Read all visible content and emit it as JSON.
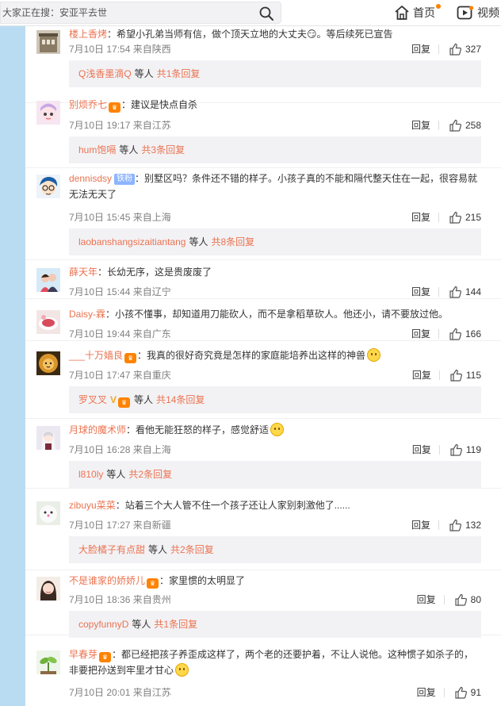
{
  "search": {
    "placeholder": "大家正在搜：安亚平去世"
  },
  "nav": {
    "home_label": "首页",
    "video_label": "视频"
  },
  "colors": {
    "link": "#eb7350",
    "meta": "#808080",
    "subbox_bg": "#f2f2f5",
    "sidebar": "#b9dcf3",
    "accent": "#ff8200"
  },
  "actions": {
    "reply_label": "回复",
    "more_replies_prefix": "共",
    "more_replies_suffix": "条回复",
    "people_suffix": "等人"
  },
  "comments": [
    {
      "user": "楼上香烤",
      "badges": [],
      "text": "：希望小孔弟当师有信，做个顶天立地的大丈夫😏。等后续死已宣告",
      "emoji_end": false,
      "time": "7月10日 17:54",
      "source": "来自陕西",
      "likes": "327",
      "sub": {
        "user": "Q浅香墨滴Q",
        "count": "1"
      },
      "avatar": "avatar-building"
    },
    {
      "user": "别烦乔七",
      "badges": [
        "vip"
      ],
      "text": "：建议是快点自杀",
      "emoji_end": false,
      "time": "7月10日 19:17",
      "source": "来自江苏",
      "likes": "258",
      "sub": {
        "user": "hum饱嗝",
        "count": "3"
      },
      "avatar": "avatar-anime-pink"
    },
    {
      "user": "dennisdsy",
      "badges": [
        "fan"
      ],
      "fan_label": "铁粉",
      "text": "：别墅区吗？条件还不错的样子。小孩子真的不能和隔代整天住在一起，很容易就无法无天了",
      "emoji_end": false,
      "time": "7月10日 15:45",
      "source": "来自上海",
      "likes": "215",
      "sub": {
        "user": "laobanshangsizaitiantang",
        "count": "8"
      },
      "avatar": "avatar-glasses-boy"
    },
    {
      "user": "薛天年",
      "badges": [],
      "text": "：长幼无序，这是贵废废了",
      "emoji_end": false,
      "time": "7月10日 15:44",
      "source": "来自辽宁",
      "likes": "144",
      "sub": null,
      "avatar": "avatar-couple"
    },
    {
      "user": "Daisy-霖",
      "badges": [],
      "text": "：小孩不懂事，却知道用刀能砍人，而不是拿稻草砍人。他还小，请不要放过他。",
      "emoji_end": false,
      "time": "7月10日 19:44",
      "source": "来自广东",
      "likes": "166",
      "sub": null,
      "avatar": "avatar-red-food"
    },
    {
      "user": "___十万嫱良",
      "badges": [
        "vip"
      ],
      "text": "：我真的很好奇究竟是怎样的家庭能培养出这样的神兽",
      "emoji_end": true,
      "time": "7月10日 17:47",
      "source": "来自重庆",
      "likes": "115",
      "sub": {
        "user": "罗叉叉",
        "count": "14",
        "extra_badges": true
      },
      "avatar": "avatar-lion"
    },
    {
      "user": "月球的魔术师",
      "badges": [],
      "text": "：看他无能狂怒的样子，感觉舒适",
      "emoji_end": true,
      "time": "7月10日 16:28",
      "source": "来自上海",
      "likes": "119",
      "sub": {
        "user": "l810ly",
        "count": "2"
      },
      "avatar": "avatar-anime-white"
    },
    {
      "user": "zibuyu菜菜",
      "badges": [],
      "text": "：站着三个大人管不住一个孩子还让人家别刺激他了......",
      "emoji_end": false,
      "time": "7月10日 17:27",
      "source": "来自新疆",
      "likes": "132",
      "sub": {
        "user": "大脸橘子有点甜",
        "count": "2"
      },
      "avatar": "avatar-fluffy"
    },
    {
      "user": "不是谁家的娇娇儿",
      "badges": [
        "vip"
      ],
      "text": "：家里惯的太明显了",
      "emoji_end": false,
      "time": "7月10日 18:36",
      "source": "来自贵州",
      "likes": "80",
      "sub": {
        "user": "copyfunnyD",
        "count": "1"
      },
      "avatar": "avatar-girl"
    },
    {
      "user": "早春芽",
      "badges": [
        "vip"
      ],
      "text": "：都已经把孩子养歪成这样了，两个老的还要护着，不让人说他。这种惯子如杀子的，非要把孙送到牢里才甘心",
      "emoji_end": true,
      "time": "7月10日 20:01",
      "source": "来自江苏",
      "likes": "91",
      "sub": null,
      "avatar": "avatar-sprout"
    }
  ]
}
